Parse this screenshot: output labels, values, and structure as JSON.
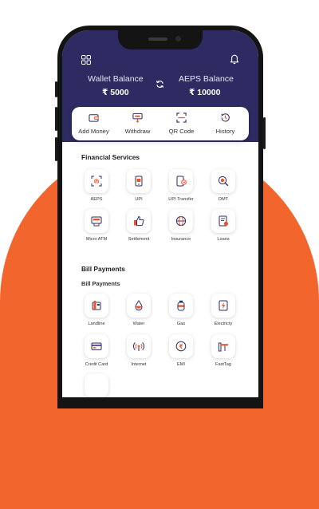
{
  "header": {
    "wallet_label": "Wallet Balance",
    "wallet_value": "₹ 5000",
    "aeps_label": "AEPS Balance",
    "aeps_value": "₹ 10000"
  },
  "quick_actions": [
    {
      "label": "Add Money",
      "icon": "wallet-icon"
    },
    {
      "label": "Withdraw",
      "icon": "withdraw-icon"
    },
    {
      "label": "QR Code",
      "icon": "qr-scan-icon"
    },
    {
      "label": "History",
      "icon": "history-icon"
    }
  ],
  "financial_services": {
    "title": "Financial Services",
    "items": [
      {
        "label": "AEPS",
        "icon": "fingerprint-icon"
      },
      {
        "label": "UPI",
        "icon": "upi-phone-icon"
      },
      {
        "label": "UPI Transfer",
        "icon": "upi-transfer-icon"
      },
      {
        "label": "DMT",
        "icon": "money-search-icon"
      },
      {
        "label": "Micro ATM",
        "icon": "micro-atm-icon"
      },
      {
        "label": "Settlement",
        "icon": "thumbs-up-icon"
      },
      {
        "label": "Insurance",
        "icon": "globe-icon"
      },
      {
        "label": "Loans",
        "icon": "loan-document-icon"
      }
    ]
  },
  "bill_payments": {
    "title": "Bill Payments",
    "subtitle": "Bill Payments",
    "items": [
      {
        "label": "Landline",
        "icon": "landline-icon"
      },
      {
        "label": "Water",
        "icon": "water-drop-icon"
      },
      {
        "label": "Gas",
        "icon": "gas-cylinder-icon"
      },
      {
        "label": "Electricty",
        "icon": "electricity-icon"
      },
      {
        "label": "Credit Card",
        "icon": "credit-card-icon"
      },
      {
        "label": "Internet",
        "icon": "wifi-icon"
      },
      {
        "label": "EMI",
        "icon": "rupee-coin-icon"
      },
      {
        "label": "FastTag",
        "icon": "toll-barrier-icon"
      }
    ]
  },
  "colors": {
    "header": "#2e2b63",
    "accent": "#f2662e",
    "background_arch": "#f2662e",
    "icon_orange": "#e8552a",
    "icon_navy": "#2e2b63"
  }
}
